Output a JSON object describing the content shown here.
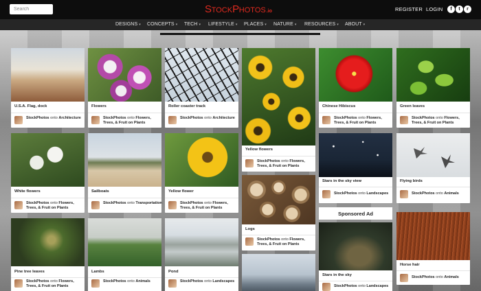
{
  "header": {
    "search_placeholder": "Search",
    "logo_big1": "S",
    "logo_small1": "TOCK",
    "logo_big2": "P",
    "logo_small2": "HOTOS",
    "logo_io": ".io",
    "register": "REGISTER",
    "login": "LOGIN",
    "social": [
      {
        "icon": "facebook-icon",
        "glyph": "f"
      },
      {
        "icon": "twitter-icon",
        "glyph": "t"
      },
      {
        "icon": "rss-icon",
        "glyph": "r"
      }
    ]
  },
  "nav": [
    "DESIGNS",
    "CONCEPTS",
    "TECH",
    "LIFESTYLE",
    "PLACES",
    "NATURE",
    "RESOURCES",
    "ABOUT"
  ],
  "nav_caret": "▾",
  "cards": [
    {
      "title": "U.S.A. Flag, dock",
      "author": "StockPhotos",
      "onto": "onto",
      "board1": "Architecture",
      "board2": ""
    },
    {
      "title": "Flowers",
      "author": "StockPhotos",
      "onto": "onto",
      "board1": "Flowers,",
      "board2": "Trees, & Fruit on Plants"
    },
    {
      "title": "Roller coaster track",
      "author": "StockPhotos",
      "onto": "onto",
      "board1": "Architecture",
      "board2": ""
    },
    {
      "title": "Yellow flowers",
      "author": "StockPhotos",
      "onto": "onto",
      "board1": "Flowers,",
      "board2": "Trees, & Fruit on Plants"
    },
    {
      "title": "Chinese Hibiscus",
      "author": "StockPhotos",
      "onto": "onto",
      "board1": "Flowers,",
      "board2": "Trees, & Fruit on Plants"
    },
    {
      "title": "Green leaves",
      "author": "StockPhotos",
      "onto": "onto",
      "board1": "Flowers,",
      "board2": "Trees, & Fruit on Plants"
    },
    {
      "title": "White flowers",
      "author": "StockPhotos",
      "onto": "onto",
      "board1": "Flowers,",
      "board2": "Trees, & Fruit on Plants"
    },
    {
      "title": "Sailboats",
      "author": "StockPhotos",
      "onto": "onto",
      "board1": "Transportation",
      "board2": ""
    },
    {
      "title": "Yellow flower",
      "author": "StockPhotos",
      "onto": "onto",
      "board1": "Flowers,",
      "board2": "Trees, & Fruit on Plants"
    },
    {
      "title": "Stars in the sky view",
      "author": "StockPhotos",
      "onto": "onto",
      "board1": "Landscapes",
      "board2": ""
    },
    {
      "title": "Flying birds",
      "author": "StockPhotos",
      "onto": "onto",
      "board1": "Animals",
      "board2": ""
    },
    {
      "title": "Logs",
      "author": "StockPhotos",
      "onto": "onto",
      "board1": "Flowers,",
      "board2": "Trees, & Fruit on Plants"
    },
    {
      "title": "Pine tree leaves",
      "author": "StockPhotos",
      "onto": "onto",
      "board1": "Flowers,",
      "board2": "Trees, & Fruit on Plants"
    },
    {
      "title": "Lambs",
      "author": "StockPhotos",
      "onto": "onto",
      "board1": "Animals",
      "board2": ""
    },
    {
      "title": "Pond",
      "author": "StockPhotos",
      "onto": "onto",
      "board1": "Landscapes",
      "board2": ""
    },
    {
      "title": "Stars in the sky",
      "author": "StockPhotos",
      "onto": "onto",
      "board1": "Landscapes",
      "board2": ""
    },
    {
      "title": "Horse hair",
      "author": "StockPhotos",
      "onto": "onto",
      "board1": "Animals",
      "board2": ""
    }
  ],
  "sponsored": "Sponsored Ad"
}
